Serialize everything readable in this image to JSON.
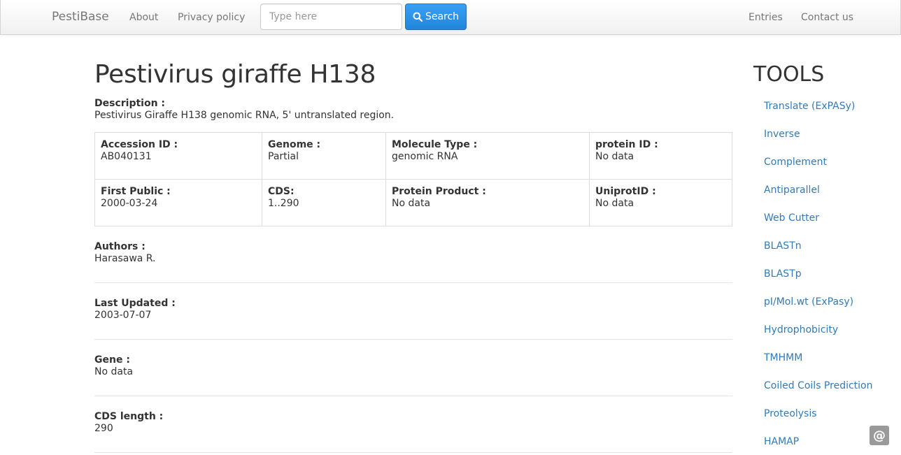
{
  "nav": {
    "brand": "PestiBase",
    "links_left": [
      "About",
      "Privacy policy"
    ],
    "search_placeholder": "Type here",
    "search_button_label": "Search",
    "search_icon": "search-icon",
    "links_right": [
      "Entries",
      "Contact us"
    ]
  },
  "entry": {
    "title": "Pestivirus giraffe H138",
    "description_label": "Description :",
    "description": "Pestivirus Giraffe H138 genomic RNA, 5' untranslated region.",
    "table": [
      [
        {
          "label": "Accession ID :",
          "value": "AB040131"
        },
        {
          "label": "Genome :",
          "value": "Partial"
        },
        {
          "label": "Molecule Type :",
          "value": "genomic RNA"
        },
        {
          "label": "protein ID :",
          "value": "No data"
        }
      ],
      [
        {
          "label": "First Public :",
          "value": "2000-03-24"
        },
        {
          "label": "CDS:",
          "value": "1..290"
        },
        {
          "label": "Protein Product :",
          "value": "No data"
        },
        {
          "label": "UniprotID :",
          "value": "No data"
        }
      ]
    ],
    "fields": [
      {
        "label": "Authors :",
        "value": "Harasawa R."
      },
      {
        "label": "Last Updated :",
        "value": "2003-07-07"
      },
      {
        "label": "Gene :",
        "value": "No data"
      },
      {
        "label": "CDS length :",
        "value": "290"
      }
    ]
  },
  "tools": {
    "title": "TOOLS",
    "items": [
      "Translate (ExPASy)",
      "Inverse",
      "Complement",
      "Antiparallel",
      "Web Cutter",
      "BLASTn",
      "BLASTp",
      "pI/Mol.wt (ExPasy)",
      "Hydrophobicity",
      "TMHMM",
      "Coiled Coils Prediction",
      "Proteolysis",
      "HAMAP"
    ]
  },
  "badge": {
    "symbol": "@",
    "icon": "at-sign-icon"
  },
  "colors": {
    "link": "#337ab7",
    "search_button": "#2a8fe6",
    "navbar_text": "#777777",
    "text": "#333333"
  }
}
